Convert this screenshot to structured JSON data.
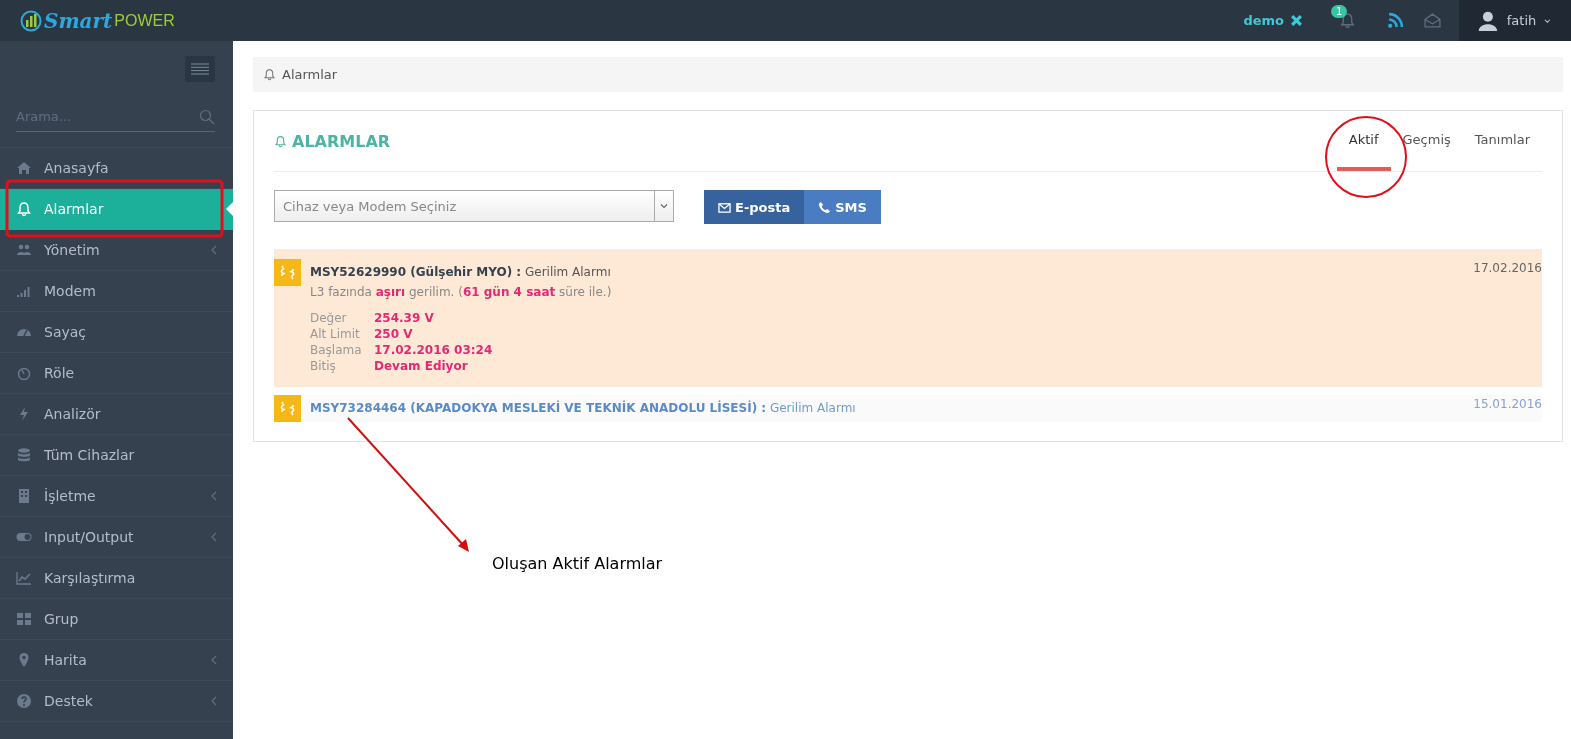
{
  "topbar": {
    "logo_main": "Smart",
    "logo_sub": "POWER",
    "account": "demo",
    "notification_count": "1",
    "user": "fatih"
  },
  "sidebar": {
    "search": {
      "placeholder": "Arama..."
    },
    "items": [
      {
        "kind": "home",
        "label": "Anasayfa",
        "selected": false,
        "submenu": false
      },
      {
        "kind": "bell",
        "label": "Alarmlar",
        "selected": true,
        "submenu": false
      },
      {
        "kind": "users",
        "label": "Yönetim",
        "selected": false,
        "submenu": true
      },
      {
        "kind": "signal",
        "label": "Modem",
        "selected": false,
        "submenu": false
      },
      {
        "kind": "gauge",
        "label": "Sayaç",
        "selected": false,
        "submenu": false
      },
      {
        "kind": "relay",
        "label": "Röle",
        "selected": false,
        "submenu": false
      },
      {
        "kind": "bolt",
        "label": "Analizör",
        "selected": false,
        "submenu": false
      },
      {
        "kind": "database",
        "label": "Tüm Cihazlar",
        "selected": false,
        "submenu": false
      },
      {
        "kind": "building",
        "label": "İşletme",
        "selected": false,
        "submenu": true
      },
      {
        "kind": "toggle",
        "label": "Input/Output",
        "selected": false,
        "submenu": true
      },
      {
        "kind": "chart",
        "label": "Karşılaştırma",
        "selected": false,
        "submenu": false
      },
      {
        "kind": "grid",
        "label": "Grup",
        "selected": false,
        "submenu": false
      },
      {
        "kind": "pin",
        "label": "Harita",
        "selected": false,
        "submenu": true
      },
      {
        "kind": "help",
        "label": "Destek",
        "selected": false,
        "submenu": true
      }
    ]
  },
  "breadcrumb": "Alarmlar",
  "portlet": {
    "title": "ALARMLAR",
    "tabs": [
      {
        "label": "Aktif",
        "selected": true
      },
      {
        "label": "Geçmiş",
        "selected": false
      },
      {
        "label": "Tanımlar",
        "selected": false
      }
    ],
    "device_select": {
      "placeholder": "Cihaz veya Modem Seçiniz"
    },
    "buttons": [
      {
        "kind": "mail",
        "label": "E-posta"
      },
      {
        "kind": "phone",
        "label": "SMS"
      }
    ],
    "alarms": [
      {
        "title": "**MSY52629990 (Gülşehir MYO) :** Gerilim Alarmı",
        "date": "17.02.2016",
        "expanded": true,
        "message": "L3 fazında **aşırı** gerilim. (**61 gün 4 saat** süre ile.)",
        "details": [
          {
            "label": "Değer",
            "value": "254.39 V"
          },
          {
            "label": "Alt Limit",
            "value": "250 V"
          },
          {
            "label": "Başlama",
            "value": "17.02.2016 03:24"
          },
          {
            "label": "Bitiş",
            "value": "Devam Ediyor"
          }
        ]
      },
      {
        "title": "**MSY73284464 (KAPADOKYA MESLEKİ VE TEKNİK ANADOLU LİSESİ) :** Gerilim Alarmı",
        "date": "15.01.2016",
        "expanded": false
      }
    ]
  },
  "annotation": {
    "caption": "Oluşan Aktif Alarmlar"
  }
}
